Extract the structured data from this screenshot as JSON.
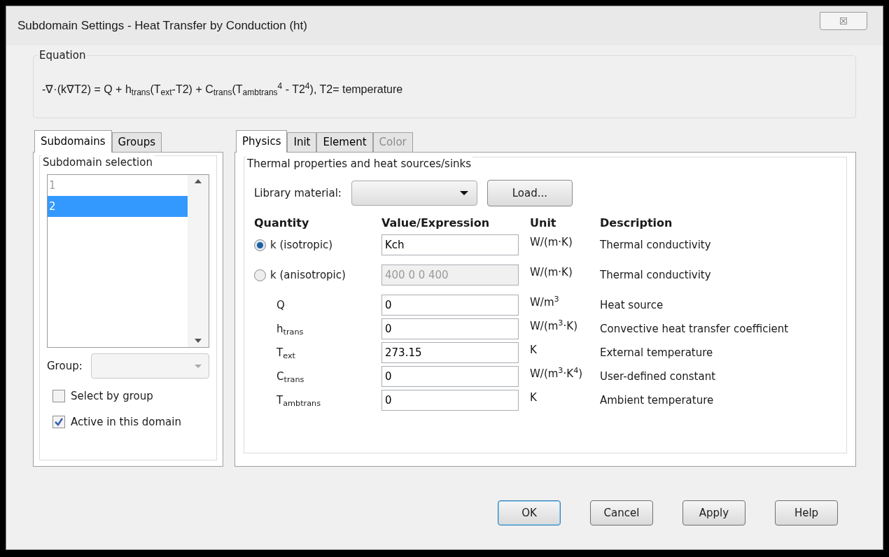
{
  "window": {
    "title": "Subdomain Settings - Heat Transfer by Conduction (ht)",
    "close": "☒"
  },
  "equation": {
    "label": "Equation",
    "text": "-∇·(k∇T2) = Q + h$_{trans}$(T$_{ext}$-T2) + C$_{trans}$(T$_{ambtrans}$$^{4}$ - T2$^{4}$), T2= temperature"
  },
  "left_tabs": [
    {
      "label": "Subdomains",
      "selected": true
    },
    {
      "label": "Groups",
      "selected": false
    }
  ],
  "subdomain_selection": {
    "label": "Subdomain selection",
    "items": [
      {
        "label": "1",
        "selected": false,
        "disabled": true
      },
      {
        "label": "2",
        "selected": true,
        "disabled": false
      }
    ],
    "group_label": "Group:"
  },
  "checkboxes": [
    {
      "label": "Select by group",
      "checked": false
    },
    {
      "label": "Active in this domain",
      "checked": true
    }
  ],
  "right_tabs": [
    {
      "label": "Physics",
      "selected": true,
      "disabled": false
    },
    {
      "label": "Init",
      "selected": false,
      "disabled": false
    },
    {
      "label": "Element",
      "selected": false,
      "disabled": false
    },
    {
      "label": "Color",
      "selected": false,
      "disabled": true
    }
  ],
  "physics": {
    "group_label": "Thermal properties and heat sources/sinks",
    "library_label": "Library material:",
    "load_button": "Load...",
    "columns": [
      "Quantity",
      "Value/Expression",
      "Unit",
      "Description"
    ],
    "rows": [
      {
        "kind": "radio",
        "selected": true,
        "quantity": "k (isotropic)",
        "value": "Kch",
        "disabled": false,
        "unit": "W/(m·K)",
        "description": "Thermal conductivity"
      },
      {
        "kind": "radio",
        "selected": false,
        "quantity": "k (anisotropic)",
        "value": "400 0 0 400",
        "disabled": true,
        "unit": "W/(m·K)",
        "description": "Thermal conductivity"
      },
      {
        "kind": "plain",
        "quantity": "Q",
        "value": "0",
        "disabled": false,
        "unit": "W/m$^{3}$",
        "description": "Heat source"
      },
      {
        "kind": "plain",
        "quantity": "h$_{trans}$",
        "value": "0",
        "disabled": false,
        "unit": "W/(m$^{3}$·K)",
        "description": "Convective heat transfer coefficient"
      },
      {
        "kind": "plain",
        "quantity": "T$_{ext}$",
        "value": "273.15",
        "disabled": false,
        "unit": "K",
        "description": "External temperature"
      },
      {
        "kind": "plain",
        "quantity": "C$_{trans}$",
        "value": "0",
        "disabled": false,
        "unit": "W/(m$^{3}$·K$^{4}$)",
        "description": "User-defined constant"
      },
      {
        "kind": "plain",
        "quantity": "T$_{ambtrans}$",
        "value": "0",
        "disabled": false,
        "unit": "K",
        "description": "Ambient temperature"
      }
    ]
  },
  "buttons": [
    {
      "label": "OK",
      "default": true
    },
    {
      "label": "Cancel",
      "default": false
    },
    {
      "label": "Apply",
      "default": false
    },
    {
      "label": "Help",
      "default": false
    }
  ]
}
